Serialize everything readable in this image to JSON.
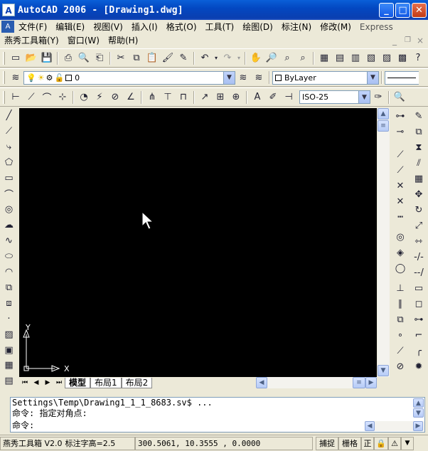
{
  "window": {
    "title": "AutoCAD 2006 - [Drawing1.dwg]",
    "app_icon": "A"
  },
  "menubar_main": [
    "文件(F)",
    "编辑(E)",
    "视图(V)",
    "插入(I)",
    "格式(O)",
    "工具(T)",
    "绘图(D)",
    "标注(N)",
    "修改(M)",
    "Express"
  ],
  "menubar_secondary": [
    "燕秀工具箱(Y)",
    "窗口(W)",
    "帮助(H)"
  ],
  "layers": {
    "current_layer": "0",
    "color_combo": "ByLayer"
  },
  "dimstyle": {
    "value": "ISO-25"
  },
  "drawing": {
    "axis_y": "Y",
    "axis_x": "X",
    "colors": {
      "background": "#000000",
      "ucs": "#ffffff"
    }
  },
  "tabs": [
    "模型",
    "布局1",
    "布局2"
  ],
  "command": {
    "history_1": "Settings\\Temp\\Drawing1_1_1_8683.sv$ ...",
    "history_2": "命令: 指定对角点:",
    "prompt": "命令:"
  },
  "status": {
    "plugin": "燕秀工具箱 V2.0",
    "dim_height": "标注字高=2.5",
    "coords": "300.5061,   10.3555 , 0.0000",
    "snap": "捕捉",
    "grid": "栅格",
    "ortho": "正"
  }
}
